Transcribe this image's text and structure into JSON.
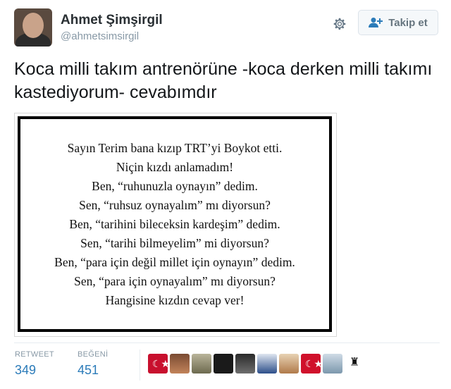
{
  "tweet": {
    "author": {
      "name": "Ahmet Şimşirgil",
      "handle": "@ahmetsimsirgil"
    },
    "follow_label": "Takip et",
    "text": "Koca milli takım antrenörüne -koca derken milli takımı kastediyorum- cevabımdır",
    "image_lines": [
      "Sayın Terim bana kızıp TRT’yi Boykot etti.",
      "Niçin kızdı anlamadım!",
      "Ben, “ruhunuzla oynayın” dedim.",
      "Sen, “ruhsuz oynayalım” mı diyorsun?",
      "Ben, “tarihini bileceksin kardeşim” dedim.",
      "Sen, “tarihi bilmeyelim” mi diyorsun?",
      "Ben, “para için değil millet için oynayın” dedim.",
      "Sen, “para için oynayalım” mı diyorsun?",
      "Hangisine kızdın cevap ver!"
    ],
    "stats": {
      "retweet_label": "RETWEET",
      "retweet_count": "349",
      "like_label": "BEĞENİ",
      "like_count": "451"
    },
    "likers": [
      {
        "icon": "turkish-flag-avatar",
        "color": "#c8102e"
      },
      {
        "icon": "group-photo-avatar",
        "color": "#7a4b32"
      },
      {
        "icon": "landscape-avatar",
        "color": "#8a8a6a"
      },
      {
        "icon": "dark-avatar",
        "color": "#1a1a1a"
      },
      {
        "icon": "portrait-avatar",
        "color": "#4a4a4a"
      },
      {
        "icon": "blue-figure-avatar",
        "color": "#2d4f8a"
      },
      {
        "icon": "portrait-avatar-light",
        "color": "#c9a073"
      },
      {
        "icon": "turkish-flag-avatar",
        "color": "#d0112b"
      },
      {
        "icon": "sky-avatar",
        "color": "#9ab5c8"
      },
      {
        "icon": "silhouette-avatar",
        "color": "#ffffff"
      }
    ]
  },
  "colors": {
    "link_blue": "#2b7bb9",
    "muted_gray": "#8899a6"
  }
}
